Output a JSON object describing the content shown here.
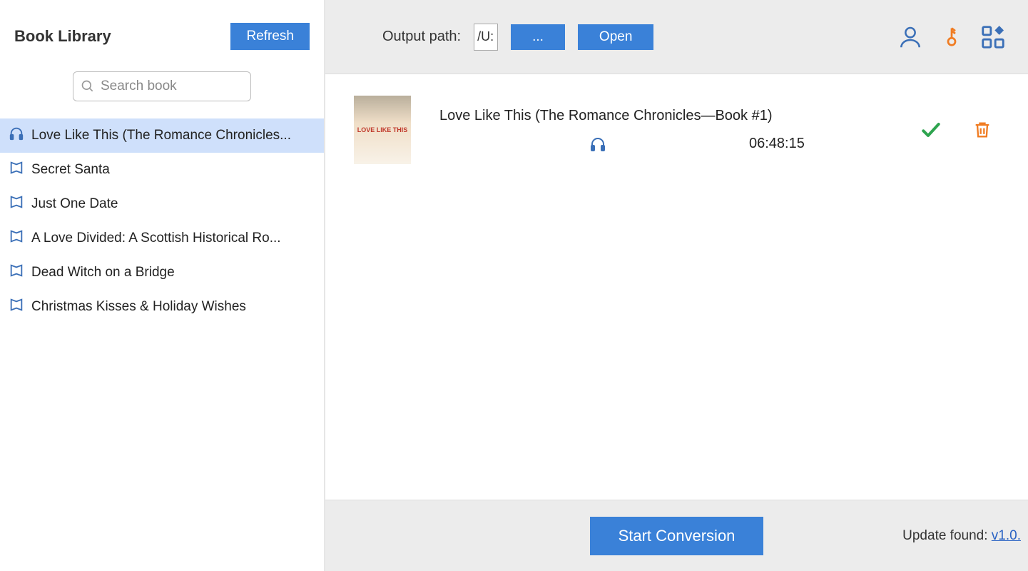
{
  "sidebar": {
    "title": "Book Library",
    "refresh_label": "Refresh",
    "search_placeholder": "Search book",
    "items": [
      {
        "title": "Love Like This (The Romance Chronicles...",
        "type": "audio",
        "selected": true
      },
      {
        "title": "Secret Santa",
        "type": "book",
        "selected": false
      },
      {
        "title": "Just One Date",
        "type": "book",
        "selected": false
      },
      {
        "title": "A Love Divided: A Scottish Historical Ro...",
        "type": "book",
        "selected": false
      },
      {
        "title": "Dead Witch on a Bridge",
        "type": "book",
        "selected": false
      },
      {
        "title": "Christmas Kisses & Holiday Wishes",
        "type": "book",
        "selected": false
      }
    ]
  },
  "toolbar": {
    "output_path_label": "Output path:",
    "output_path_value": "/U:",
    "browse_label": "...",
    "open_label": "Open"
  },
  "queue": {
    "items": [
      {
        "title": "Love Like This (The Romance Chronicles—Book #1)",
        "duration": "06:48:15",
        "cover_text": "LOVE LIKE THIS"
      }
    ]
  },
  "footer": {
    "start_label": "Start Conversion",
    "update_prefix": "Update found: ",
    "update_version": "v1.0."
  },
  "colors": {
    "primary": "#3a81d8",
    "accent_orange": "#f07c22",
    "success": "#2ea44f",
    "icon_blue": "#3a6fb7"
  }
}
